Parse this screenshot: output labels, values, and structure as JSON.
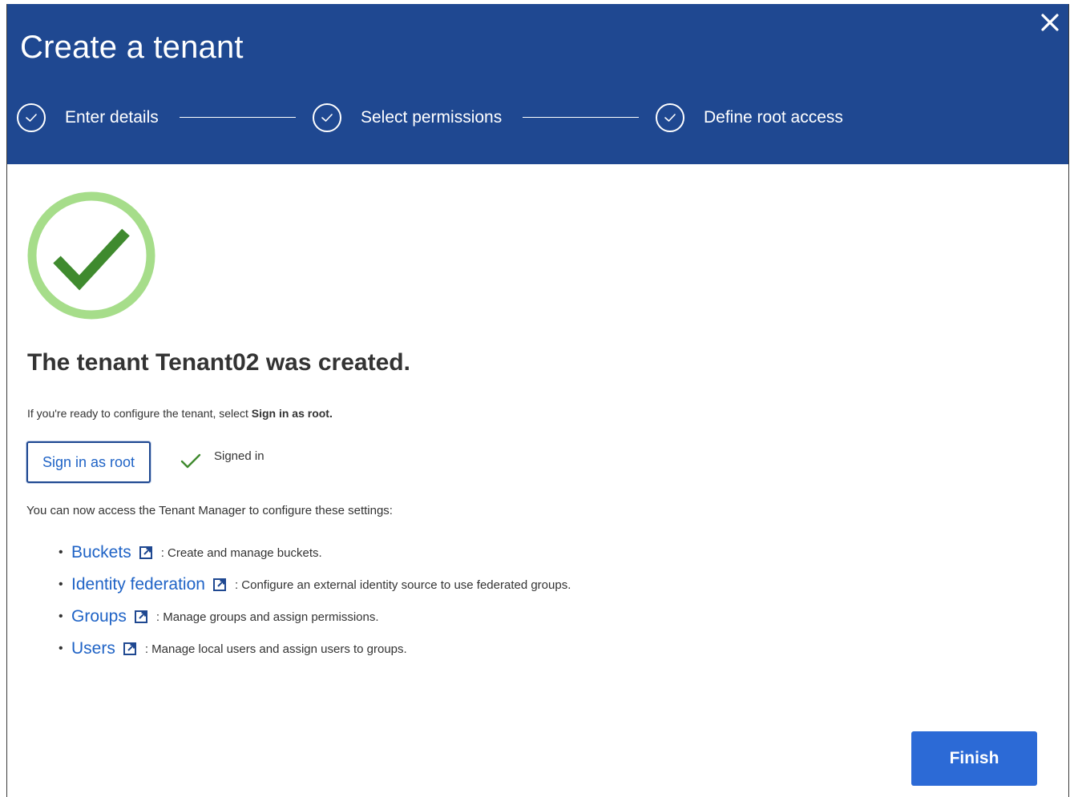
{
  "dialog": {
    "title": "Create a tenant",
    "close_icon": "close-icon"
  },
  "steps": [
    {
      "label": "Enter details",
      "icon": "check-circle-icon",
      "state": "complete"
    },
    {
      "label": "Select permissions",
      "icon": "check-circle-icon",
      "state": "complete"
    },
    {
      "label": "Define root access",
      "icon": "check-circle-icon",
      "state": "complete"
    }
  ],
  "result": {
    "heading": "The tenant Tenant02 was created.",
    "intro_prefix": "If you're ready to configure the tenant, select ",
    "intro_bold": "Sign in as root.",
    "sign_in_button": "Sign in as root",
    "signed_in_status": "Signed in",
    "access_text": "You can now access the Tenant Manager to configure these settings:"
  },
  "settings_links": [
    {
      "label": "Buckets",
      "description": ": Create and manage buckets.",
      "icon": "external-link-icon"
    },
    {
      "label": "Identity federation",
      "description": ": Configure an external identity source to use federated groups.",
      "icon": "external-link-icon"
    },
    {
      "label": "Groups",
      "description": ": Manage groups and assign permissions.",
      "icon": "external-link-icon"
    },
    {
      "label": "Users",
      "description": ": Manage local users and assign users to groups.",
      "icon": "external-link-icon"
    }
  ],
  "footer": {
    "finish_button": "Finish"
  },
  "colors": {
    "header_bg": "#1f4891",
    "link": "#1f63c6",
    "primary_button": "#2c6ad6",
    "success_ring": "#a6dd8a",
    "success_check": "#3f8a2e"
  }
}
